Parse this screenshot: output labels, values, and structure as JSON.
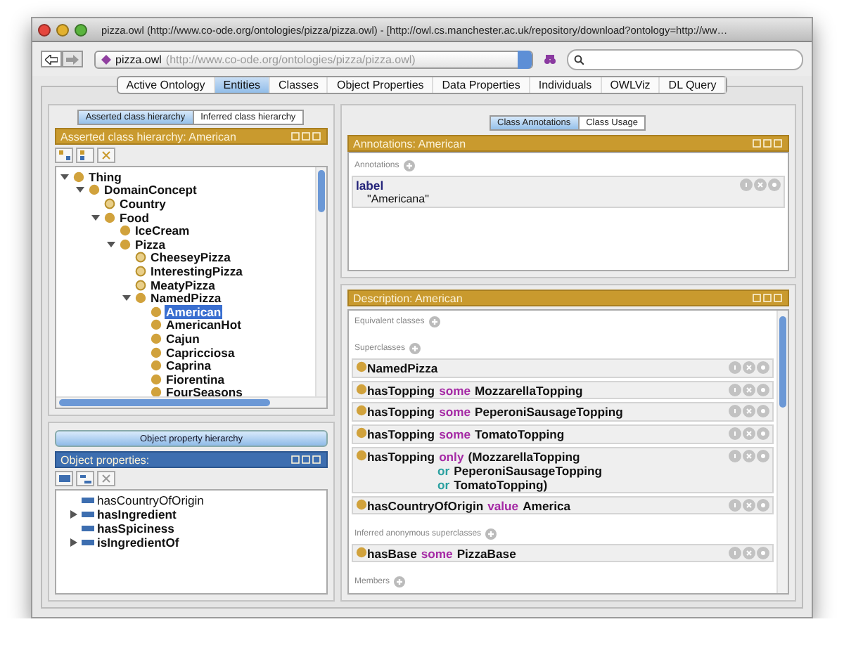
{
  "window": {
    "title": "pizza.owl (http://www.co-ode.org/ontologies/pizza/pizza.owl) - [http://owl.cs.manchester.ac.uk/repository/download?ontology=http://ww…"
  },
  "toolbar": {
    "ontology_name": "pizza.owl",
    "ontology_uri": "(http://www.co-ode.org/ontologies/pizza/pizza.owl)"
  },
  "tabs": [
    {
      "label": "Active Ontology",
      "selected": false
    },
    {
      "label": "Entities",
      "selected": true
    },
    {
      "label": "Classes",
      "selected": false
    },
    {
      "label": "Object Properties",
      "selected": false
    },
    {
      "label": "Data Properties",
      "selected": false
    },
    {
      "label": "Individuals",
      "selected": false
    },
    {
      "label": "OWLViz",
      "selected": false
    },
    {
      "label": "DL Query",
      "selected": false
    }
  ],
  "class_hierarchy": {
    "view_tabs": [
      {
        "label": "Asserted class hierarchy",
        "selected": true
      },
      {
        "label": "Inferred class hierarchy",
        "selected": false
      }
    ],
    "header": "Asserted class hierarchy: American",
    "tree": [
      {
        "label": "Thing",
        "kind": "primitive",
        "expanded": true,
        "selected": false,
        "children": [
          {
            "label": "DomainConcept",
            "kind": "primitive",
            "expanded": true,
            "selected": false,
            "children": [
              {
                "label": "Country",
                "kind": "defined",
                "selected": false
              },
              {
                "label": "Food",
                "kind": "primitive",
                "expanded": true,
                "selected": false,
                "children": [
                  {
                    "label": "IceCream",
                    "kind": "primitive",
                    "selected": false
                  },
                  {
                    "label": "Pizza",
                    "kind": "primitive",
                    "expanded": true,
                    "selected": false,
                    "children": [
                      {
                        "label": "CheeseyPizza",
                        "kind": "defined",
                        "selected": false
                      },
                      {
                        "label": "InterestingPizza",
                        "kind": "defined",
                        "selected": false
                      },
                      {
                        "label": "MeatyPizza",
                        "kind": "defined",
                        "selected": false
                      },
                      {
                        "label": "NamedPizza",
                        "kind": "primitive",
                        "expanded": true,
                        "selected": false,
                        "children": [
                          {
                            "label": "American",
                            "kind": "primitive",
                            "selected": true
                          },
                          {
                            "label": "AmericanHot",
                            "kind": "primitive",
                            "selected": false
                          },
                          {
                            "label": "Cajun",
                            "kind": "primitive",
                            "selected": false
                          },
                          {
                            "label": "Capricciosa",
                            "kind": "primitive",
                            "selected": false
                          },
                          {
                            "label": "Caprina",
                            "kind": "primitive",
                            "selected": false
                          },
                          {
                            "label": "Fiorentina",
                            "kind": "primitive",
                            "selected": false
                          },
                          {
                            "label": "FourSeasons",
                            "kind": "primitive",
                            "selected": false
                          }
                        ]
                      }
                    ]
                  }
                ]
              }
            ]
          }
        ]
      }
    ]
  },
  "property_hierarchy": {
    "button": "Object property hierarchy",
    "header": "Object properties:",
    "items": [
      {
        "label": "hasCountryOfOrigin",
        "expandable": false
      },
      {
        "label": "hasIngredient",
        "expandable": true
      },
      {
        "label": "hasSpiciness",
        "expandable": false
      },
      {
        "label": "isIngredientOf",
        "expandable": true
      }
    ]
  },
  "annotations": {
    "view_tabs": [
      {
        "label": "Class Annotations",
        "selected": true
      },
      {
        "label": "Class Usage",
        "selected": false
      }
    ],
    "header": "Annotations: American",
    "section": "Annotations",
    "entries": [
      {
        "property": "label",
        "value": "\"Americana\""
      }
    ]
  },
  "description": {
    "header": "Description: American",
    "sections": [
      {
        "title": "Equivalent classes"
      },
      {
        "title": "Superclasses",
        "items": [
          {
            "lines": [
              [
                {
                  "text": "NamedPizza",
                  "kind": "entity"
                }
              ]
            ]
          },
          {
            "lines": [
              [
                {
                  "text": "hasTopping",
                  "kind": "entity"
                },
                {
                  "text": "some",
                  "kind": "keyword"
                },
                {
                  "text": "MozzarellaTopping",
                  "kind": "entity"
                }
              ]
            ]
          },
          {
            "lines": [
              [
                {
                  "text": "hasTopping",
                  "kind": "entity"
                },
                {
                  "text": "some",
                  "kind": "keyword"
                },
                {
                  "text": "PeperoniSausageTopping",
                  "kind": "entity"
                }
              ]
            ]
          },
          {
            "lines": [
              [
                {
                  "text": "hasTopping",
                  "kind": "entity"
                },
                {
                  "text": "some",
                  "kind": "keyword"
                },
                {
                  "text": "TomatoTopping",
                  "kind": "entity"
                }
              ]
            ]
          },
          {
            "lines": [
              [
                {
                  "text": "hasTopping",
                  "kind": "entity"
                },
                {
                  "text": "only",
                  "kind": "keyword"
                },
                {
                  "text": "(MozzarellaTopping",
                  "kind": "entity"
                }
              ],
              [
                {
                  "text": "or",
                  "kind": "connective"
                },
                {
                  "text": "PeperoniSausageTopping",
                  "kind": "entity"
                }
              ],
              [
                {
                  "text": "or",
                  "kind": "connective"
                },
                {
                  "text": "TomatoTopping)",
                  "kind": "entity"
                }
              ]
            ]
          },
          {
            "lines": [
              [
                {
                  "text": "hasCountryOfOrigin",
                  "kind": "entity"
                },
                {
                  "text": "value",
                  "kind": "keyword"
                },
                {
                  "text": "America",
                  "kind": "entity"
                }
              ]
            ]
          }
        ]
      },
      {
        "title": "Inferred anonymous superclasses",
        "items": [
          {
            "lines": [
              [
                {
                  "text": "hasBase",
                  "kind": "entity"
                },
                {
                  "text": "some",
                  "kind": "keyword"
                },
                {
                  "text": "PizzaBase",
                  "kind": "entity"
                }
              ]
            ]
          }
        ]
      },
      {
        "title": "Members"
      }
    ]
  }
}
